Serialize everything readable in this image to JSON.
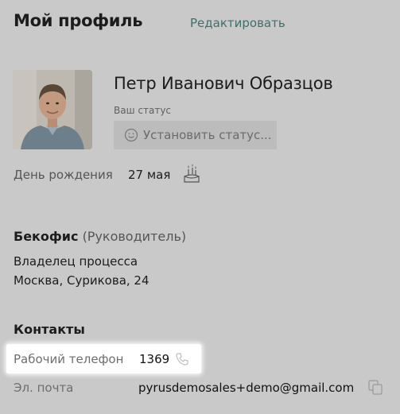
{
  "header": {
    "title": "Мой профиль",
    "edit_label": "Редактировать"
  },
  "profile": {
    "full_name": "Петр Иванович Образцов",
    "status_caption": "Ваш статус",
    "set_status_label": "Установить статус..."
  },
  "birthday": {
    "label": "День рождения",
    "value": "27 мая"
  },
  "department": {
    "name": "Бекофис",
    "role": "(Руководитель)",
    "position": "Владелец процесса",
    "address": "Москва, Сурикова, 24"
  },
  "contacts": {
    "title": "Контакты",
    "phone_label": "Рабочий телефон",
    "phone_value": "1369",
    "email_label": "Эл. почта",
    "email_value": "pyrusdemosales+demo@gmail.com"
  },
  "icons": {
    "smile": "smile-icon",
    "birthday": "birthday-cake-icon",
    "phone": "phone-icon",
    "copy": "copy-icon"
  },
  "colors": {
    "overlay_background": "#c9c9c9",
    "link": "#3f6f6a",
    "highlight": "#ffffff"
  }
}
